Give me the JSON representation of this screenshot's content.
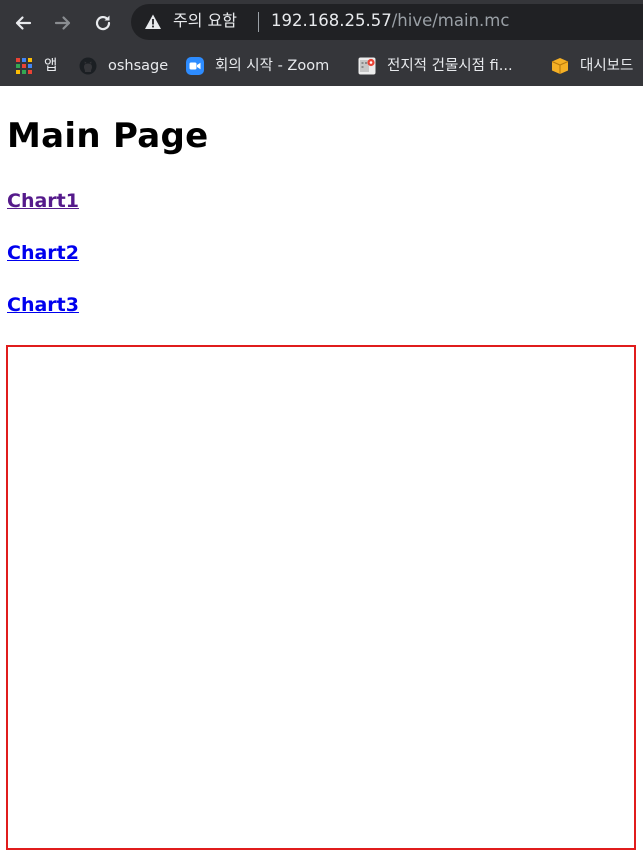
{
  "browser": {
    "omnibox": {
      "security_label": "주의 요함",
      "url_host": "192.168.25.57",
      "url_path": "/hive/main.mc"
    },
    "bookmarks": [
      {
        "label": "앱",
        "icon": "apps-grid-icon"
      },
      {
        "label": "oshsage",
        "icon": "github-icon"
      },
      {
        "label": "회의 시작 - Zoom",
        "icon": "zoom-icon"
      },
      {
        "label": "전지적 건물시점 fi...",
        "icon": "map-icon"
      },
      {
        "label": "대시보드",
        "icon": "package-icon"
      }
    ]
  },
  "page": {
    "title": "Main Page",
    "links": [
      {
        "label": "Chart1",
        "visited": true
      },
      {
        "label": "Chart2",
        "visited": false
      },
      {
        "label": "Chart3",
        "visited": false
      }
    ]
  },
  "colors": {
    "chrome_bg": "#35363a",
    "omnibox_bg": "#202124",
    "link": "#0000ee",
    "link_visited": "#551a8b",
    "frame_border": "#e01c1c"
  }
}
